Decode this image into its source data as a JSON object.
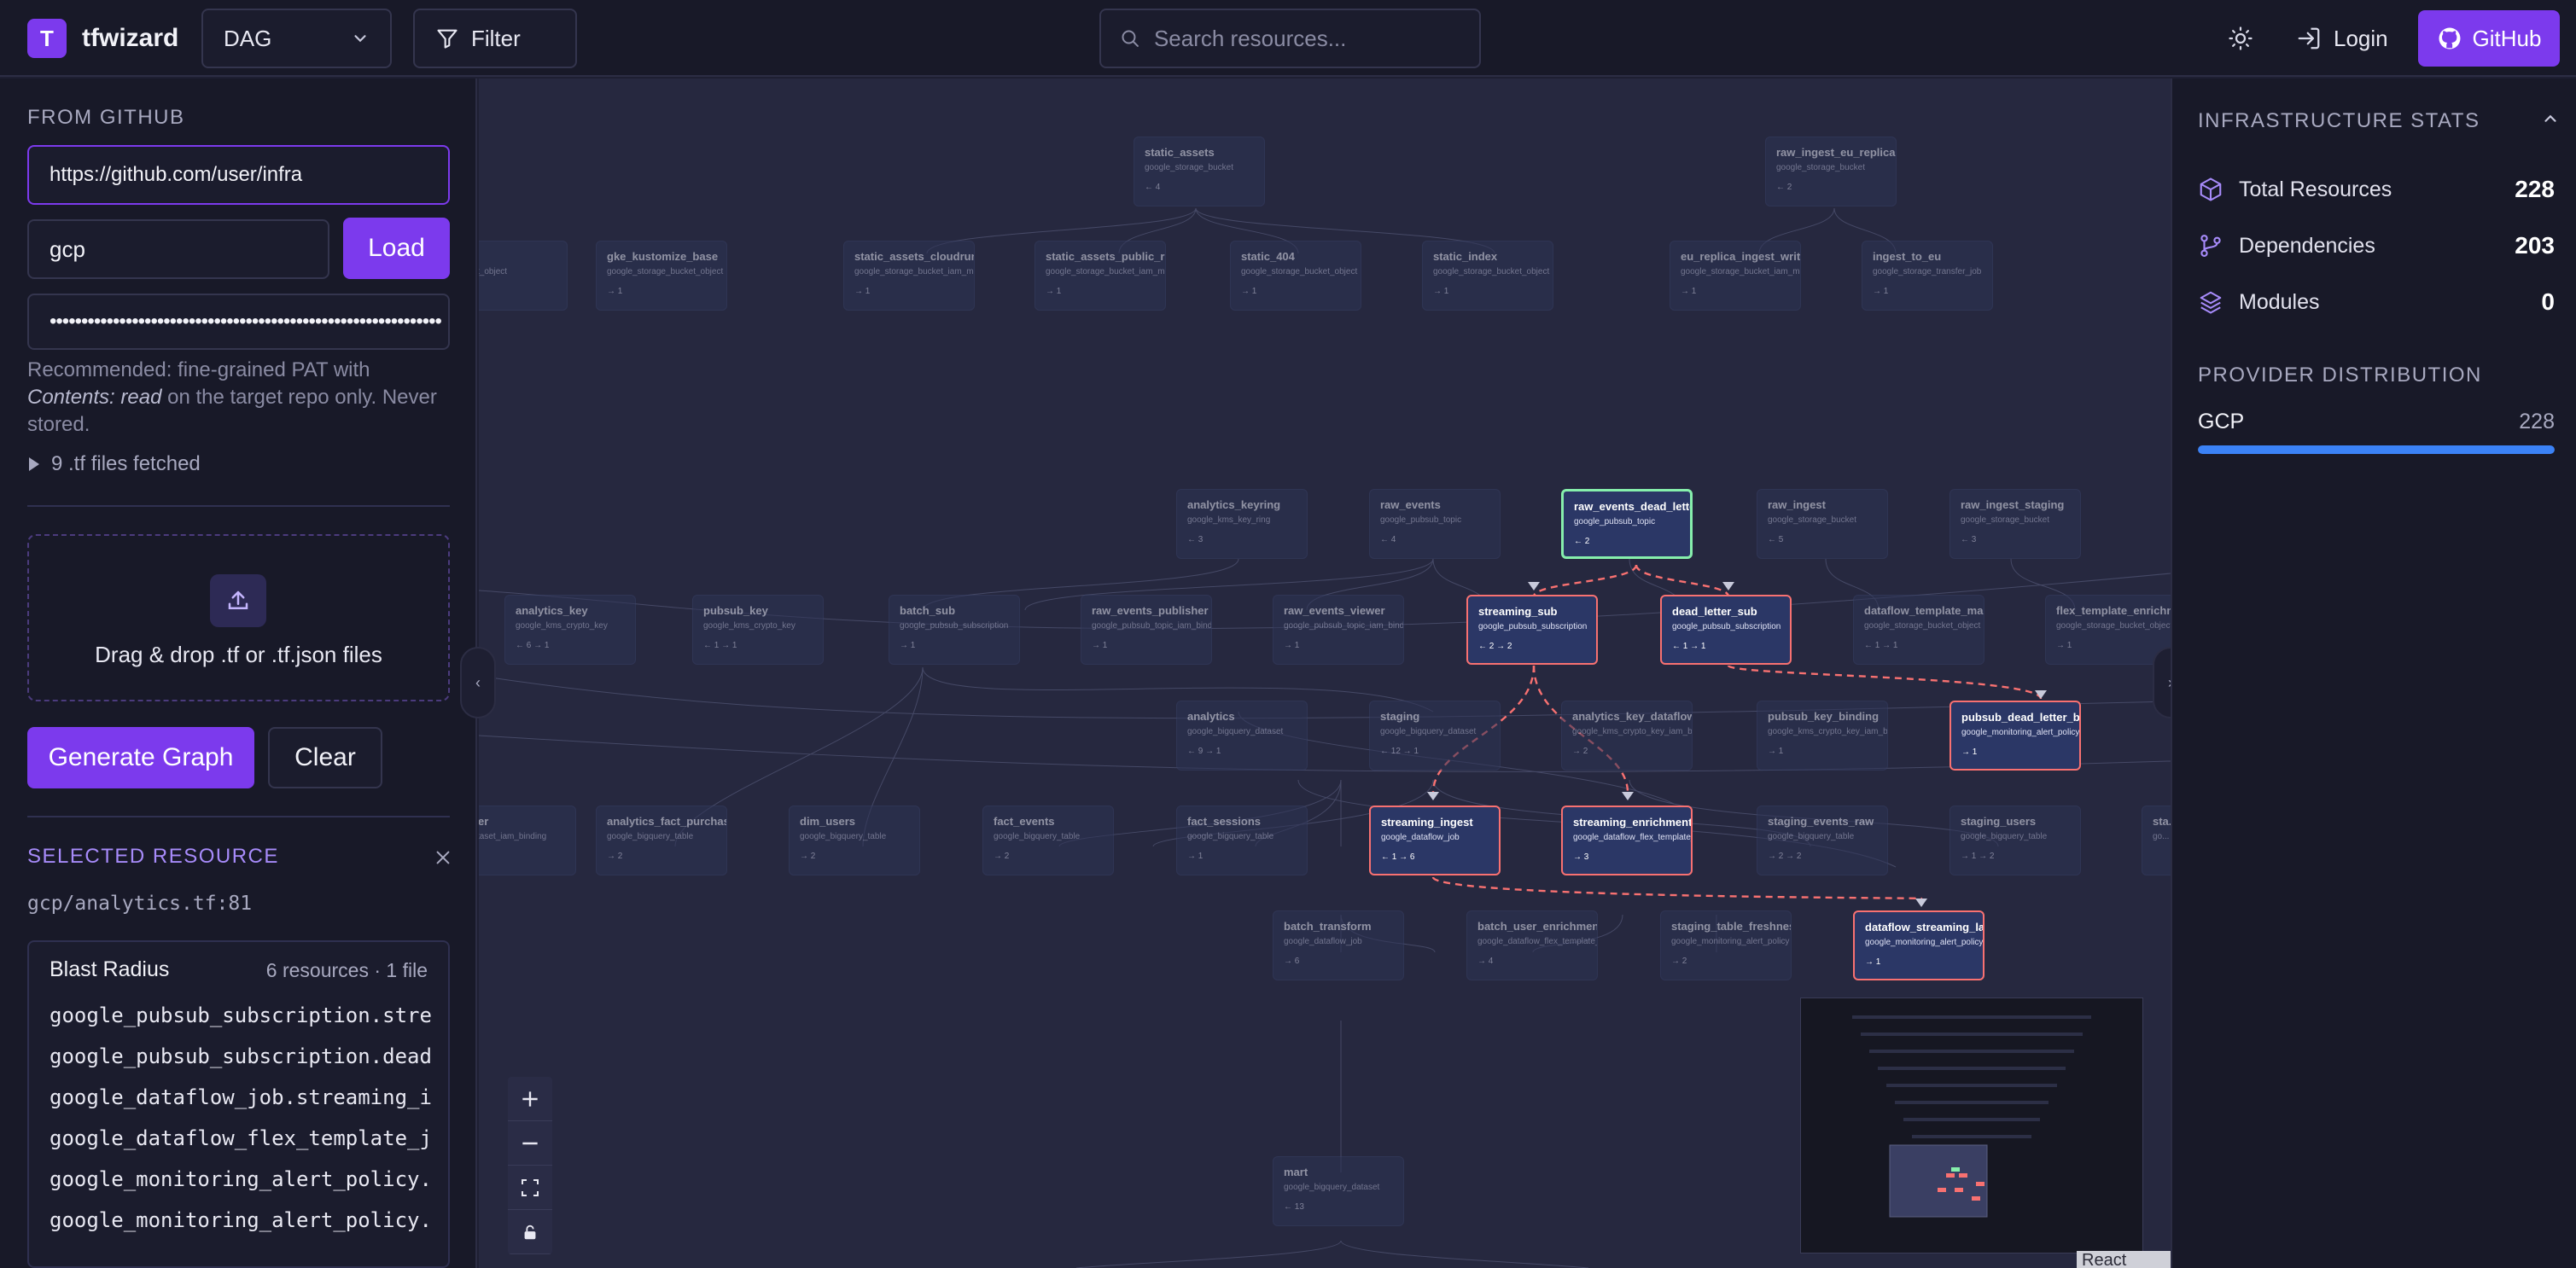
{
  "app": {
    "logo_letter": "T",
    "name": "tfwizard"
  },
  "topbar": {
    "view_select": "DAG",
    "filter_label": "Filter",
    "search_placeholder": "Search resources...",
    "login_label": "Login",
    "github_label": "GitHub"
  },
  "left": {
    "from_github_title": "FROM GITHUB",
    "repo_url": "https://github.com/user/infra",
    "provider": "gcp",
    "load_label": "Load",
    "token_mask": "••••••••••••••••••••••••••••••••••••••••••••••••••••••••••••••",
    "hint_prefix": "Recommended: fine-grained PAT with ",
    "hint_em": "Contents: read",
    "hint_suffix": " on the target repo only. Never stored.",
    "files_fetched": "9 .tf files fetched",
    "drop_label": "Drag & drop .tf or .tf.json files",
    "generate_label": "Generate Graph",
    "clear_label": "Clear",
    "selected_title": "SELECTED RESOURCE",
    "selected_path": "gcp/analytics.tf:81",
    "blast_title": "Blast Radius",
    "blast_meta": "6 resources · 1 file",
    "blast_items": [
      "google_pubsub_subscription.stre",
      "google_pubsub_subscription.dead",
      "google_dataflow_job.streaming_i",
      "google_dataflow_flex_template_j",
      "google_monitoring_alert_policy.",
      "google_monitoring_alert_policy."
    ]
  },
  "graph": {
    "nodes": [
      {
        "id": "a1",
        "name": "static_assets",
        "type": "google_storage_bucket",
        "deps": "← 4",
        "state": "dim"
      },
      {
        "id": "a2",
        "name": "raw_ingest_eu_replica",
        "type": "google_storage_bucket",
        "deps": "← 2",
        "state": "dim"
      },
      {
        "id": "b0",
        "name": "...ues",
        "type": "...bucket_object",
        "deps": "",
        "state": "dim"
      },
      {
        "id": "b1",
        "name": "gke_kustomize_base",
        "type": "google_storage_bucket_object",
        "deps": "→ 1",
        "state": "dim"
      },
      {
        "id": "b2",
        "name": "static_assets_cloudrun_writer",
        "type": "google_storage_bucket_iam_member",
        "deps": "→ 1",
        "state": "dim"
      },
      {
        "id": "b3",
        "name": "static_assets_public_reader",
        "type": "google_storage_bucket_iam_member",
        "deps": "→ 1",
        "state": "dim"
      },
      {
        "id": "b4",
        "name": "static_404",
        "type": "google_storage_bucket_object",
        "deps": "→ 1",
        "state": "dim"
      },
      {
        "id": "b5",
        "name": "static_index",
        "type": "google_storage_bucket_object",
        "deps": "→ 1",
        "state": "dim"
      },
      {
        "id": "b6",
        "name": "eu_replica_ingest_writer",
        "type": "google_storage_bucket_iam_member",
        "deps": "→ 1",
        "state": "dim"
      },
      {
        "id": "b7",
        "name": "ingest_to_eu",
        "type": "google_storage_transfer_job",
        "deps": "→ 1",
        "state": "dim"
      },
      {
        "id": "c1",
        "name": "analytics_keyring",
        "type": "google_kms_key_ring",
        "deps": "← 3",
        "state": "dim"
      },
      {
        "id": "c2",
        "name": "raw_events",
        "type": "google_pubsub_topic",
        "deps": "← 4",
        "state": "dim"
      },
      {
        "id": "c3",
        "name": "raw_events_dead_letter",
        "type": "google_pubsub_topic",
        "deps": "← 2",
        "state": "root"
      },
      {
        "id": "c4",
        "name": "raw_ingest",
        "type": "google_storage_bucket",
        "deps": "← 5",
        "state": "dim"
      },
      {
        "id": "c5",
        "name": "raw_ingest_staging",
        "type": "google_storage_bucket",
        "deps": "← 3",
        "state": "dim"
      },
      {
        "id": "d1",
        "name": "analytics_key",
        "type": "google_kms_crypto_key",
        "deps": "← 6  → 1",
        "state": "dim"
      },
      {
        "id": "d2",
        "name": "pubsub_key",
        "type": "google_kms_crypto_key",
        "deps": "← 1  → 1",
        "state": "dim"
      },
      {
        "id": "d3",
        "name": "batch_sub",
        "type": "google_pubsub_subscription",
        "deps": "→ 1",
        "state": "dim"
      },
      {
        "id": "d4",
        "name": "raw_events_publisher",
        "type": "google_pubsub_topic_iam_binding",
        "deps": "→ 1",
        "state": "dim"
      },
      {
        "id": "d5",
        "name": "raw_events_viewer",
        "type": "google_pubsub_topic_iam_binding",
        "deps": "→ 1",
        "state": "dim"
      },
      {
        "id": "d6",
        "name": "streaming_sub",
        "type": "google_pubsub_subscription",
        "deps": "← 2  → 2",
        "state": "hl"
      },
      {
        "id": "d7",
        "name": "dead_letter_sub",
        "type": "google_pubsub_subscription",
        "deps": "← 1  → 1",
        "state": "hl"
      },
      {
        "id": "d8",
        "name": "dataflow_template_main",
        "type": "google_storage_bucket_object",
        "deps": "← 1  → 1",
        "state": "dim"
      },
      {
        "id": "d9",
        "name": "flex_template_enrichment",
        "type": "google_storage_bucket_object",
        "deps": "→ 1",
        "state": "dim"
      },
      {
        "id": "e1",
        "name": "analytics",
        "type": "google_bigquery_dataset",
        "deps": "← 9  → 1",
        "state": "dim"
      },
      {
        "id": "e2",
        "name": "staging",
        "type": "google_bigquery_dataset",
        "deps": "← 12  → 1",
        "state": "dim"
      },
      {
        "id": "e3",
        "name": "analytics_key_dataflow",
        "type": "google_kms_crypto_key_iam_binding",
        "deps": "→ 2",
        "state": "dim"
      },
      {
        "id": "e4",
        "name": "pubsub_key_binding",
        "type": "google_kms_crypto_key_iam_binding",
        "deps": "→ 1",
        "state": "dim"
      },
      {
        "id": "e5",
        "name": "pubsub_dead_letter_backlog",
        "type": "google_monitoring_alert_policy",
        "deps": "→ 1",
        "state": "hl"
      },
      {
        "id": "f0",
        "name": "...ader",
        "type": "..._dataset_iam_binding",
        "deps": "",
        "state": "dim"
      },
      {
        "id": "f1",
        "name": "analytics_fact_purchases",
        "type": "google_bigquery_table",
        "deps": "→ 2",
        "state": "dim"
      },
      {
        "id": "f2",
        "name": "dim_users",
        "type": "google_bigquery_table",
        "deps": "→ 2",
        "state": "dim"
      },
      {
        "id": "f3",
        "name": "fact_events",
        "type": "google_bigquery_table",
        "deps": "→ 2",
        "state": "dim"
      },
      {
        "id": "f4",
        "name": "fact_sessions",
        "type": "google_bigquery_table",
        "deps": "→ 1",
        "state": "dim"
      },
      {
        "id": "f5",
        "name": "streaming_ingest",
        "type": "google_dataflow_job",
        "deps": "← 1  → 6",
        "state": "hl"
      },
      {
        "id": "f6",
        "name": "streaming_enrichment",
        "type": "google_dataflow_flex_template_job",
        "deps": "→ 3",
        "state": "hl"
      },
      {
        "id": "f7",
        "name": "staging_events_raw",
        "type": "google_bigquery_table",
        "deps": "→ 2  → 2",
        "state": "dim"
      },
      {
        "id": "f8",
        "name": "staging_users",
        "type": "google_bigquery_table",
        "deps": "→ 1  → 2",
        "state": "dim"
      },
      {
        "id": "f9",
        "name": "sta...",
        "type": "go...",
        "deps": "",
        "state": "dim"
      },
      {
        "id": "g1",
        "name": "batch_transform",
        "type": "google_dataflow_job",
        "deps": "→ 6",
        "state": "dim"
      },
      {
        "id": "g2",
        "name": "batch_user_enrichment",
        "type": "google_dataflow_flex_template_job",
        "deps": "→ 4",
        "state": "dim"
      },
      {
        "id": "g3",
        "name": "staging_table_freshness",
        "type": "google_monitoring_alert_policy",
        "deps": "→ 2",
        "state": "dim"
      },
      {
        "id": "g4",
        "name": "dataflow_streaming_lag",
        "type": "google_monitoring_alert_policy",
        "deps": "→ 1",
        "state": "hl"
      },
      {
        "id": "h1",
        "name": "mart",
        "type": "google_bigquery_dataset",
        "deps": "← 13",
        "state": "dim"
      }
    ],
    "attribution": "React Flow"
  },
  "right": {
    "stats_title": "INFRASTRUCTURE STATS",
    "stats": [
      {
        "label": "Total Resources",
        "value": "228",
        "icon": "cube-icon"
      },
      {
        "label": "Dependencies",
        "value": "203",
        "icon": "git-branch-icon"
      },
      {
        "label": "Modules",
        "value": "0",
        "icon": "layers-icon"
      }
    ],
    "provider_title": "PROVIDER DISTRIBUTION",
    "providers": [
      {
        "name": "GCP",
        "count": "228",
        "share": 1.0
      }
    ],
    "colors": {
      "accent": "#7c3aed",
      "provider_bar": "#3b82f6",
      "highlight_border": "#f87171",
      "root_border": "#86efac"
    }
  }
}
